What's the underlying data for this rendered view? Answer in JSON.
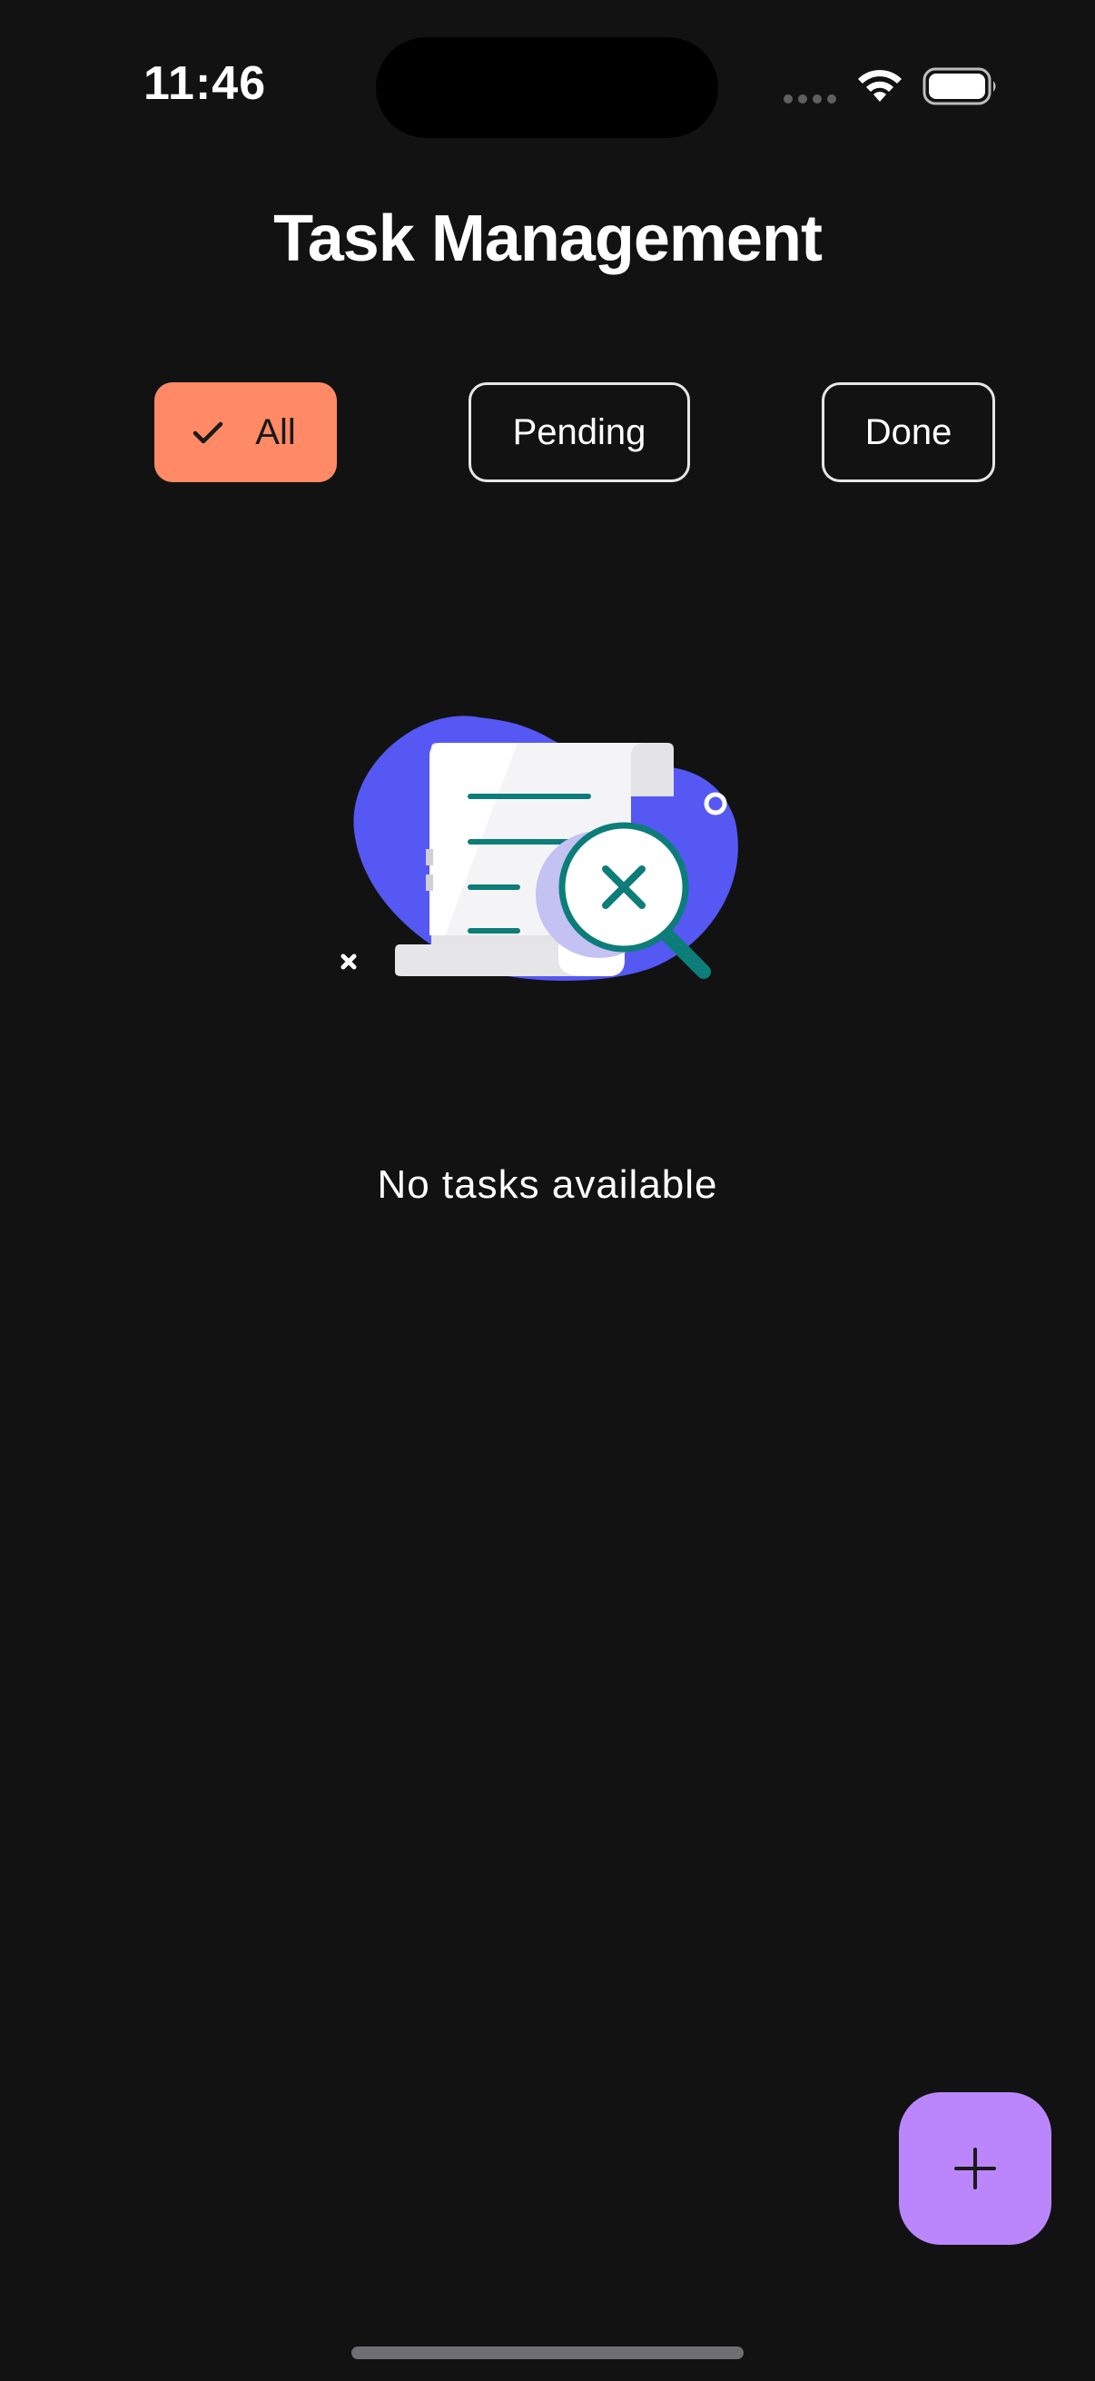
{
  "status_bar": {
    "time": "11:46"
  },
  "header": {
    "title": "Task Management"
  },
  "filters": [
    {
      "label": "All",
      "selected": true,
      "icon": "check-icon"
    },
    {
      "label": "Pending",
      "selected": false
    },
    {
      "label": "Done",
      "selected": false
    }
  ],
  "empty_state": {
    "illustration": "document-search-not-found",
    "message": "No tasks available"
  },
  "fab": {
    "icon": "plus-icon"
  },
  "colors": {
    "background": "#121213",
    "chip_selected": "#ff8a65",
    "fab": "#bb86fc",
    "illustration_blob": "#5558f2",
    "illustration_accent": "#0d7d7a"
  }
}
